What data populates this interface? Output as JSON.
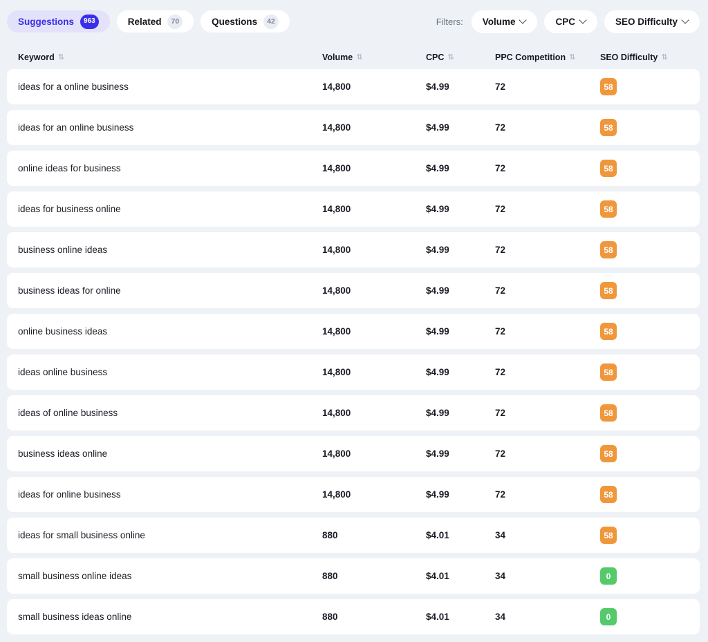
{
  "tabs": [
    {
      "label": "Suggestions",
      "count": "963",
      "active": true
    },
    {
      "label": "Related",
      "count": "70",
      "active": false
    },
    {
      "label": "Questions",
      "count": "42",
      "active": false
    }
  ],
  "filters": {
    "label": "Filters:",
    "items": [
      {
        "label": "Volume"
      },
      {
        "label": "CPC"
      },
      {
        "label": "SEO Difficulty"
      }
    ]
  },
  "table": {
    "sort_icon": "⇅",
    "columns": [
      {
        "key": "keyword",
        "label": "Keyword",
        "align": "left"
      },
      {
        "key": "volume",
        "label": "Volume",
        "align": "left"
      },
      {
        "key": "cpc",
        "label": "CPC",
        "align": "left"
      },
      {
        "key": "ppc",
        "label": "PPC Competition",
        "align": "left"
      },
      {
        "key": "seo",
        "label": "SEO Difficulty",
        "align": "left"
      }
    ],
    "rows": [
      {
        "keyword": "ideas for a online business",
        "volume": "14,800",
        "cpc": "$4.99",
        "ppc": "72",
        "seo": "58",
        "seo_color": "#f0973c"
      },
      {
        "keyword": "ideas for an online business",
        "volume": "14,800",
        "cpc": "$4.99",
        "ppc": "72",
        "seo": "58",
        "seo_color": "#f0973c"
      },
      {
        "keyword": "online ideas for business",
        "volume": "14,800",
        "cpc": "$4.99",
        "ppc": "72",
        "seo": "58",
        "seo_color": "#f0973c"
      },
      {
        "keyword": "ideas for business online",
        "volume": "14,800",
        "cpc": "$4.99",
        "ppc": "72",
        "seo": "58",
        "seo_color": "#f0973c"
      },
      {
        "keyword": "business online ideas",
        "volume": "14,800",
        "cpc": "$4.99",
        "ppc": "72",
        "seo": "58",
        "seo_color": "#f0973c"
      },
      {
        "keyword": "business ideas for online",
        "volume": "14,800",
        "cpc": "$4.99",
        "ppc": "72",
        "seo": "58",
        "seo_color": "#f0973c"
      },
      {
        "keyword": "online business ideas",
        "volume": "14,800",
        "cpc": "$4.99",
        "ppc": "72",
        "seo": "58",
        "seo_color": "#f0973c"
      },
      {
        "keyword": "ideas online business",
        "volume": "14,800",
        "cpc": "$4.99",
        "ppc": "72",
        "seo": "58",
        "seo_color": "#f0973c"
      },
      {
        "keyword": "ideas of online business",
        "volume": "14,800",
        "cpc": "$4.99",
        "ppc": "72",
        "seo": "58",
        "seo_color": "#f0973c"
      },
      {
        "keyword": "business ideas online",
        "volume": "14,800",
        "cpc": "$4.99",
        "ppc": "72",
        "seo": "58",
        "seo_color": "#f0973c"
      },
      {
        "keyword": "ideas for online business",
        "volume": "14,800",
        "cpc": "$4.99",
        "ppc": "72",
        "seo": "58",
        "seo_color": "#f0973c"
      },
      {
        "keyword": "ideas for small business online",
        "volume": "880",
        "cpc": "$4.01",
        "ppc": "34",
        "seo": "58",
        "seo_color": "#f0973c"
      },
      {
        "keyword": "small business online ideas",
        "volume": "880",
        "cpc": "$4.01",
        "ppc": "34",
        "seo": "0",
        "seo_color": "#54ca6b"
      },
      {
        "keyword": "small business ideas online",
        "volume": "880",
        "cpc": "$4.01",
        "ppc": "34",
        "seo": "0",
        "seo_color": "#54ca6b"
      }
    ]
  },
  "theme": {
    "background": "#eef2f7",
    "card": "#ffffff",
    "accent": "#3b2ee8",
    "accent_soft": "#e4e2fb",
    "badge_orange": "#f0973c",
    "badge_green": "#54ca6b"
  }
}
